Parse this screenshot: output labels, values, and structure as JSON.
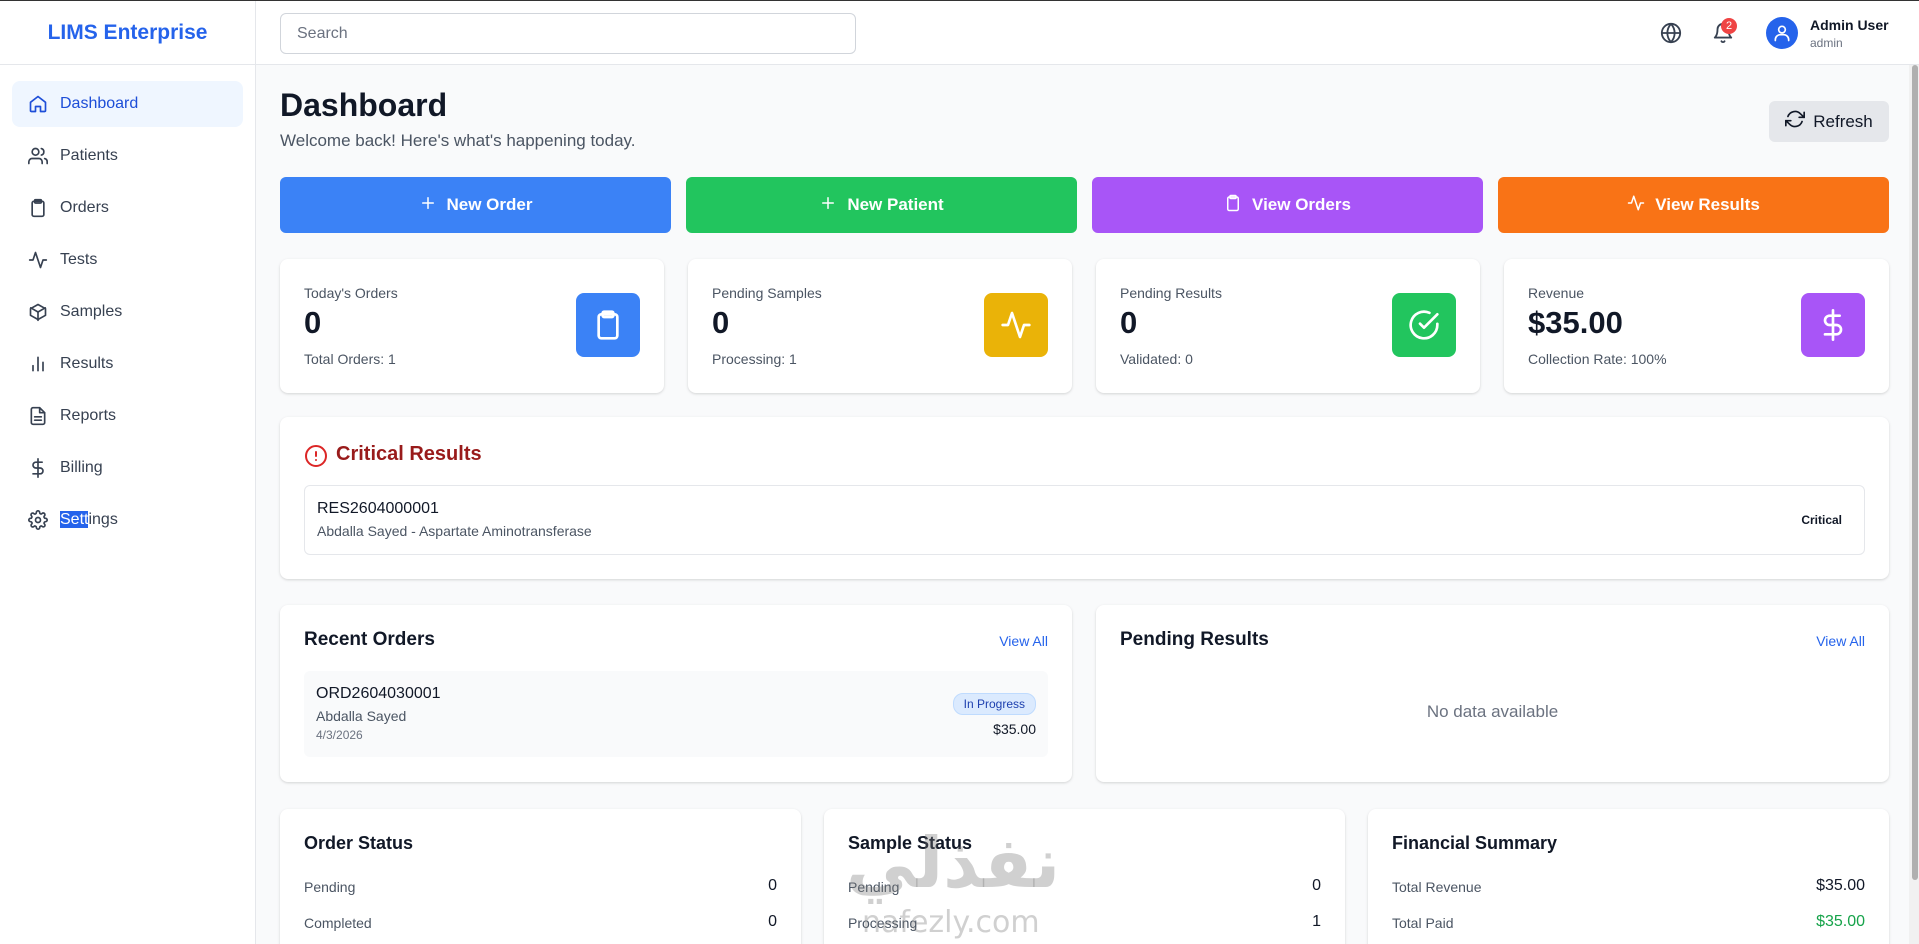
{
  "app": {
    "brand": "LIMS Enterprise"
  },
  "sidebar": {
    "items": [
      {
        "label": "Dashboard",
        "icon": "home-icon",
        "active": true
      },
      {
        "label": "Patients",
        "icon": "users-icon"
      },
      {
        "label": "Orders",
        "icon": "clipboard-icon"
      },
      {
        "label": "Tests",
        "icon": "activity-icon"
      },
      {
        "label": "Samples",
        "icon": "package-icon"
      },
      {
        "label": "Results",
        "icon": "bar-chart-icon"
      },
      {
        "label": "Reports",
        "icon": "file-text-icon"
      },
      {
        "label": "Billing",
        "icon": "dollar-icon"
      },
      {
        "label": "Settings",
        "label_selected": "Sett",
        "label_rest": "ings",
        "icon": "gear-icon"
      }
    ]
  },
  "topbar": {
    "search_placeholder": "Search",
    "notification_count": "2",
    "user_name": "Admin User",
    "user_role": "admin"
  },
  "page": {
    "title": "Dashboard",
    "subtitle": "Welcome back! Here's what's happening today.",
    "refresh_label": "Refresh"
  },
  "quick_actions": [
    {
      "label": "New Order",
      "color": "#3b82f6",
      "icon": "plus-icon"
    },
    {
      "label": "New Patient",
      "color": "#22c55e",
      "icon": "plus-icon"
    },
    {
      "label": "View Orders",
      "color": "#a855f7",
      "icon": "clipboard-icon"
    },
    {
      "label": "View Results",
      "color": "#f97316",
      "icon": "activity-icon"
    }
  ],
  "stats": [
    {
      "label": "Today's Orders",
      "value": "0",
      "sub": "Total Orders: 1",
      "color": "#3b82f6",
      "icon": "clipboard-icon"
    },
    {
      "label": "Pending Samples",
      "value": "0",
      "sub": "Processing: 1",
      "color": "#eab308",
      "icon": "activity-icon"
    },
    {
      "label": "Pending Results",
      "value": "0",
      "sub": "Validated: 0",
      "color": "#22c55e",
      "icon": "check-circle-icon"
    },
    {
      "label": "Revenue",
      "value": "$35.00",
      "sub": "Collection Rate: 100%",
      "color": "#a855f7",
      "icon": "dollar-icon"
    }
  ],
  "critical": {
    "title": "Critical Results",
    "items": [
      {
        "id": "RES2604000001",
        "description": "Abdalla Sayed - Aspartate Aminotransferase",
        "badge": "Critical"
      }
    ]
  },
  "recent_orders": {
    "title": "Recent Orders",
    "view_all": "View All",
    "items": [
      {
        "id": "ORD2604030001",
        "patient": "Abdalla Sayed",
        "date": "4/3/2026",
        "status": "In Progress",
        "amount": "$35.00"
      }
    ]
  },
  "pending_results": {
    "title": "Pending Results",
    "view_all": "View All",
    "empty": "No data available"
  },
  "order_status": {
    "title": "Order Status",
    "rows": [
      {
        "label": "Pending",
        "value": "0"
      },
      {
        "label": "Completed",
        "value": "0"
      }
    ]
  },
  "sample_status": {
    "title": "Sample Status",
    "rows": [
      {
        "label": "Pending",
        "value": "0"
      },
      {
        "label": "Processing",
        "value": "1"
      }
    ]
  },
  "financial": {
    "title": "Financial Summary",
    "rows": [
      {
        "label": "Total Revenue",
        "value": "$35.00"
      },
      {
        "label": "Total Paid",
        "value": "$35.00",
        "color": "#16a34a"
      }
    ]
  },
  "watermark": {
    "text": "نفذلي",
    "url": "nafezly.com"
  }
}
